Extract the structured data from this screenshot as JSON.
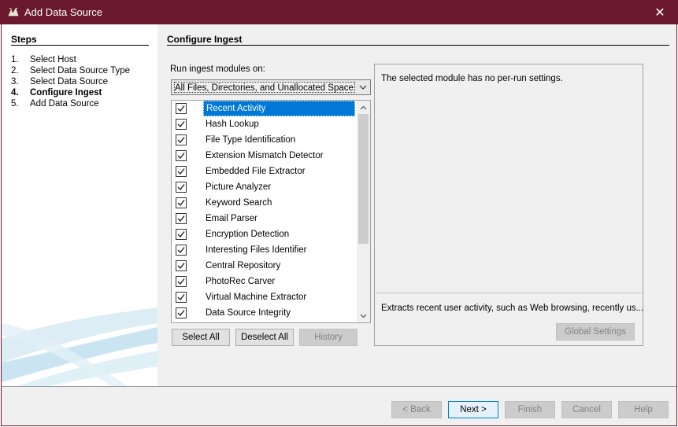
{
  "window": {
    "title": "Add Data Source",
    "close_glyph": "✕"
  },
  "steps": {
    "heading": "Steps",
    "items": [
      {
        "num": "1.",
        "label": "Select Host",
        "active": false
      },
      {
        "num": "2.",
        "label": "Select Data Source Type",
        "active": false
      },
      {
        "num": "3.",
        "label": "Select Data Source",
        "active": false
      },
      {
        "num": "4.",
        "label": "Configure Ingest",
        "active": true
      },
      {
        "num": "5.",
        "label": "Add Data Source",
        "active": false
      }
    ]
  },
  "main": {
    "heading": "Configure Ingest",
    "run_label": "Run ingest modules on:",
    "run_on_selected": "All Files, Directories, and Unallocated Space",
    "modules": [
      {
        "label": "Recent Activity",
        "checked": true,
        "selected": true
      },
      {
        "label": "Hash Lookup",
        "checked": true,
        "selected": false
      },
      {
        "label": "File Type Identification",
        "checked": true,
        "selected": false
      },
      {
        "label": "Extension Mismatch Detector",
        "checked": true,
        "selected": false
      },
      {
        "label": "Embedded File Extractor",
        "checked": true,
        "selected": false
      },
      {
        "label": "Picture Analyzer",
        "checked": true,
        "selected": false
      },
      {
        "label": "Keyword Search",
        "checked": true,
        "selected": false
      },
      {
        "label": "Email Parser",
        "checked": true,
        "selected": false
      },
      {
        "label": "Encryption Detection",
        "checked": true,
        "selected": false
      },
      {
        "label": "Interesting Files Identifier",
        "checked": true,
        "selected": false
      },
      {
        "label": "Central Repository",
        "checked": true,
        "selected": false
      },
      {
        "label": "PhotoRec Carver",
        "checked": true,
        "selected": false
      },
      {
        "label": "Virtual Machine Extractor",
        "checked": true,
        "selected": false
      },
      {
        "label": "Data Source Integrity",
        "checked": true,
        "selected": false
      }
    ],
    "select_all_label": "Select All",
    "deselect_all_label": "Deselect All",
    "history_label": "History",
    "settings_message": "The selected module has no per-run settings.",
    "module_description": "Extracts recent user activity, such as Web browsing, recently us...",
    "global_settings_label": "Global Settings"
  },
  "footer": {
    "back_label": "< Back",
    "next_label": "Next >",
    "finish_label": "Finish",
    "cancel_label": "Cancel",
    "help_label": "Help"
  },
  "colors": {
    "titlebar": "#6a1a2c",
    "selection": "#0078d7"
  }
}
